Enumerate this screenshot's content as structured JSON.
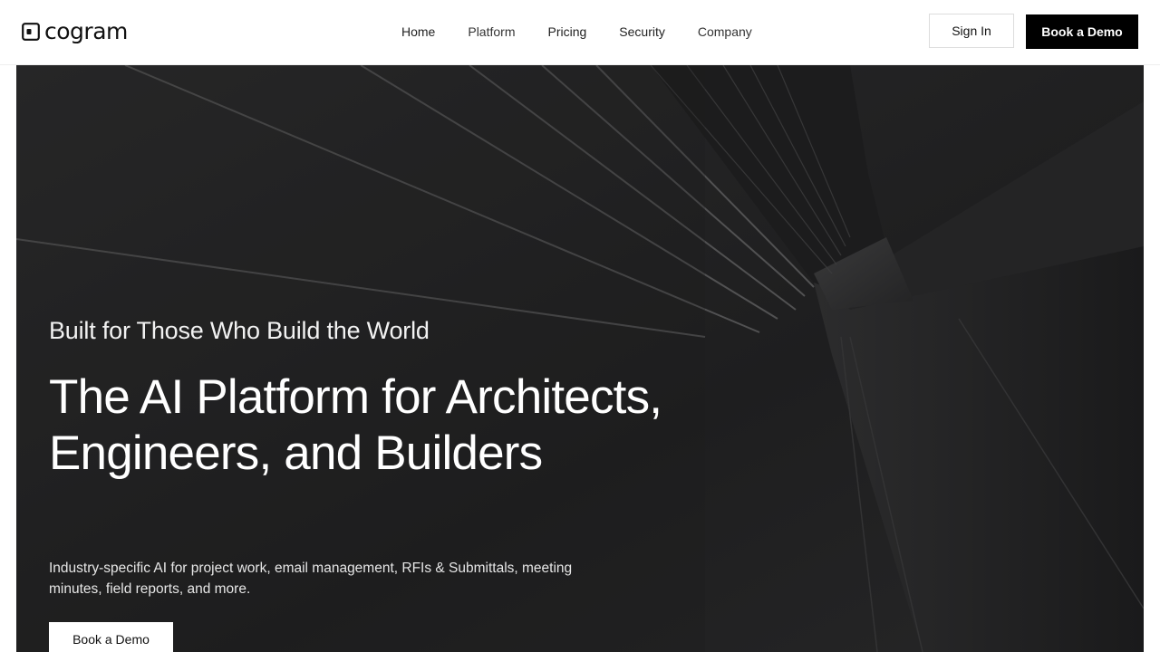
{
  "header": {
    "logo_text": "cogram",
    "nav": {
      "home": "Home",
      "platform": "Platform",
      "pricing": "Pricing",
      "security": "Security",
      "company": "Company"
    },
    "sign_in": "Sign In",
    "book_demo": "Book a Demo"
  },
  "hero": {
    "eyebrow": "Built for Those Who Build the World",
    "headline": "The AI Platform for Architects, Engineers, and Builders",
    "subtext": "Industry-specific AI for project work, email management, RFIs & Submittals, meeting minutes, field reports, and more.",
    "cta": "Book a Demo"
  },
  "colors": {
    "brand_dark": "#000000",
    "hero_bg": "#222223",
    "text_light": "#ffffff"
  },
  "icons": {
    "logo": "cogram-logo-icon"
  }
}
